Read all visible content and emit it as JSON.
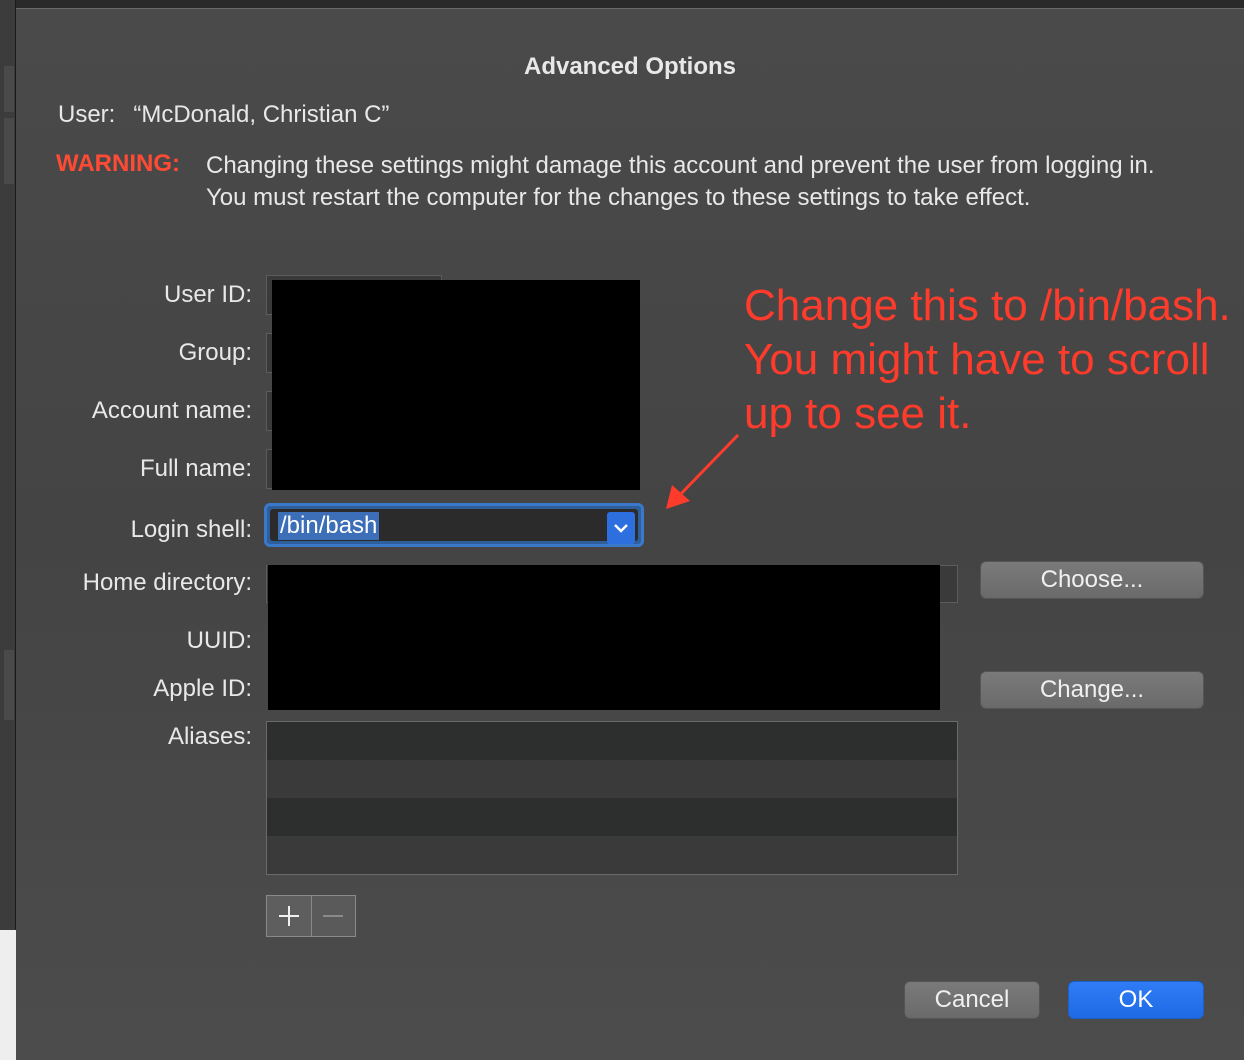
{
  "dialog": {
    "title": "Advanced Options",
    "user_label": "User:",
    "user_value": "“McDonald, Christian C”",
    "warning_label": "WARNING:",
    "warning_text": "Changing these settings might damage this account and prevent the user from logging in. You must restart the computer for the changes to these settings to take effect."
  },
  "form": {
    "user_id_label": "User ID:",
    "group_label": "Group:",
    "account_name_label": "Account name:",
    "full_name_label": "Full name:",
    "login_shell_label": "Login shell:",
    "login_shell_value": "/bin/bash",
    "home_directory_label": "Home directory:",
    "uuid_label": "UUID:",
    "apple_id_label": "Apple ID:",
    "aliases_label": "Aliases:"
  },
  "buttons": {
    "choose": "Choose...",
    "change": "Change...",
    "cancel": "Cancel",
    "ok": "OK"
  },
  "annotation": {
    "text": "Change this to /bin/bash. You might have to scroll up to see it.",
    "color": "#ff3b2b"
  },
  "colors": {
    "accent": "#2e6fe0",
    "warning": "#ff4a34"
  },
  "icons": {
    "add": "plus-icon",
    "remove": "minus-icon",
    "popup": "chevron-down-icon",
    "annotation": "arrow-icon"
  }
}
